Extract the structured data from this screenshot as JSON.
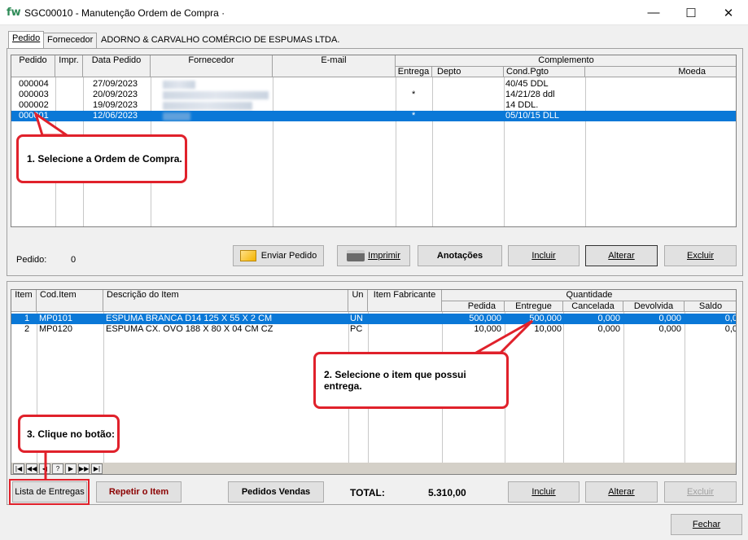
{
  "window": {
    "logo": "fw",
    "title": "SGC00010 - Manutenção Ordem de Compra ·",
    "minimize": "—",
    "maximize": "☐",
    "close": "✕"
  },
  "tabs": [
    {
      "label": "Pedido"
    },
    {
      "label": "Fornecedor"
    }
  ],
  "supplier_name": "ADORNO & CARVALHO COMÉRCIO DE ESPUMAS LTDA.",
  "orders": {
    "columns": {
      "pedido": "Pedido",
      "impr": "Impr.",
      "data": "Data Pedido",
      "fornecedor": "Fornecedor",
      "email": "E-mail",
      "complemento": "Complemento",
      "entrega": "Entrega",
      "depto": "Depto",
      "cond": "Cond.Pgto",
      "moeda": "Moeda"
    },
    "rows": [
      {
        "pedido": "000004",
        "data": "27/09/2023",
        "entrega": "",
        "cond": "40/45 DDL",
        "selected": false
      },
      {
        "pedido": "000003",
        "data": "20/09/2023",
        "entrega": "*",
        "cond": "14/21/28 ddl",
        "selected": false
      },
      {
        "pedido": "000002",
        "data": "19/09/2023",
        "entrega": "",
        "cond": "14 DDL.",
        "selected": false
      },
      {
        "pedido": "000001",
        "data": "12/06/2023",
        "entrega": "*",
        "cond": "05/10/15 DLL",
        "selected": true
      }
    ],
    "nav": [
      "|◀",
      "◀◀",
      "◀",
      "?",
      "▶",
      "▶▶",
      "▶|"
    ],
    "pedido_label": "Pedido:",
    "pedido_count": "0"
  },
  "top_buttons": {
    "enviar": "Enviar Pedido",
    "imprimir": "Imprimir",
    "anotacoes": "Anotações",
    "incluir": "Incluir",
    "alterar": "Alterar",
    "excluir": "Excluir"
  },
  "items": {
    "columns": {
      "item": "Item",
      "cod": "Cod.Item",
      "desc": "Descrição do Item",
      "un": "Un",
      "fab": "Item  Fabricante",
      "quantidade": "Quantidade",
      "pedida": "Pedida",
      "entregue": "Entregue",
      "cancelada": "Cancelada",
      "devolvida": "Devolvida",
      "saldo": "Saldo"
    },
    "rows": [
      {
        "item": "1",
        "cod": "MP0101",
        "desc": "ESPUMA BRANCA D14 125 X 55 X 2 CM",
        "un": "UN",
        "pedida": "500,000",
        "entregue": "500,000",
        "cancelada": "0,000",
        "devolvida": "0,000",
        "saldo": "0,0",
        "selected": true
      },
      {
        "item": "2",
        "cod": "MP0120",
        "desc": "ESPUMA CX. OVO 188 X 80 X 04 CM CZ",
        "un": "PC",
        "pedida": "10,000",
        "entregue": "10,000",
        "cancelada": "0,000",
        "devolvida": "0,000",
        "saldo": "0,0",
        "selected": false
      }
    ]
  },
  "bottom_buttons": {
    "lista": "Lista de Entregas",
    "repetir": "Repetir o Item",
    "pedidos_vendas": "Pedidos Vendas",
    "incluir": "Incluir",
    "alterar": "Alterar",
    "excluir": "Excluir",
    "fechar": "Fechar"
  },
  "total": {
    "label": "TOTAL:",
    "value": "5.310,00"
  },
  "callouts": {
    "step1": "1. Selecione a Ordem de Compra.",
    "step2": "2. Selecione o item que possui entrega.",
    "step3": "3. Clique no botão:"
  },
  "colors": {
    "selection": "#0a78d7",
    "callout_border": "#e0212b",
    "repeat_text": "#8b0000"
  }
}
